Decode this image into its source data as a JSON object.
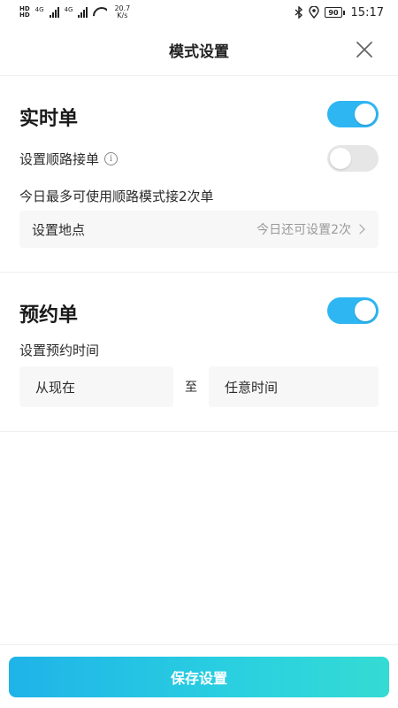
{
  "status_bar": {
    "sim1": "HD",
    "sim2": "HD",
    "net1": "4G",
    "net2": "4G",
    "speed_value": "20.7",
    "speed_unit": "K/s",
    "battery": "90",
    "time": "15:17"
  },
  "header": {
    "title": "模式设置"
  },
  "realtime": {
    "title": "实时单",
    "enabled": true,
    "shunlu_label": "设置顺路接单",
    "shunlu_enabled": false,
    "quota_text": "今日最多可使用顺路模式接2次单",
    "location_label": "设置地点",
    "location_hint": "今日还可设置2次"
  },
  "reservation": {
    "title": "预约单",
    "enabled": true,
    "time_label": "设置预约时间",
    "from_value": "从现在",
    "separator": "至",
    "to_value": "任意时间"
  },
  "footer": {
    "save_label": "保存设置"
  },
  "colors": {
    "accent": "#2eb6f2",
    "toggle_off": "#e6e6e6"
  }
}
